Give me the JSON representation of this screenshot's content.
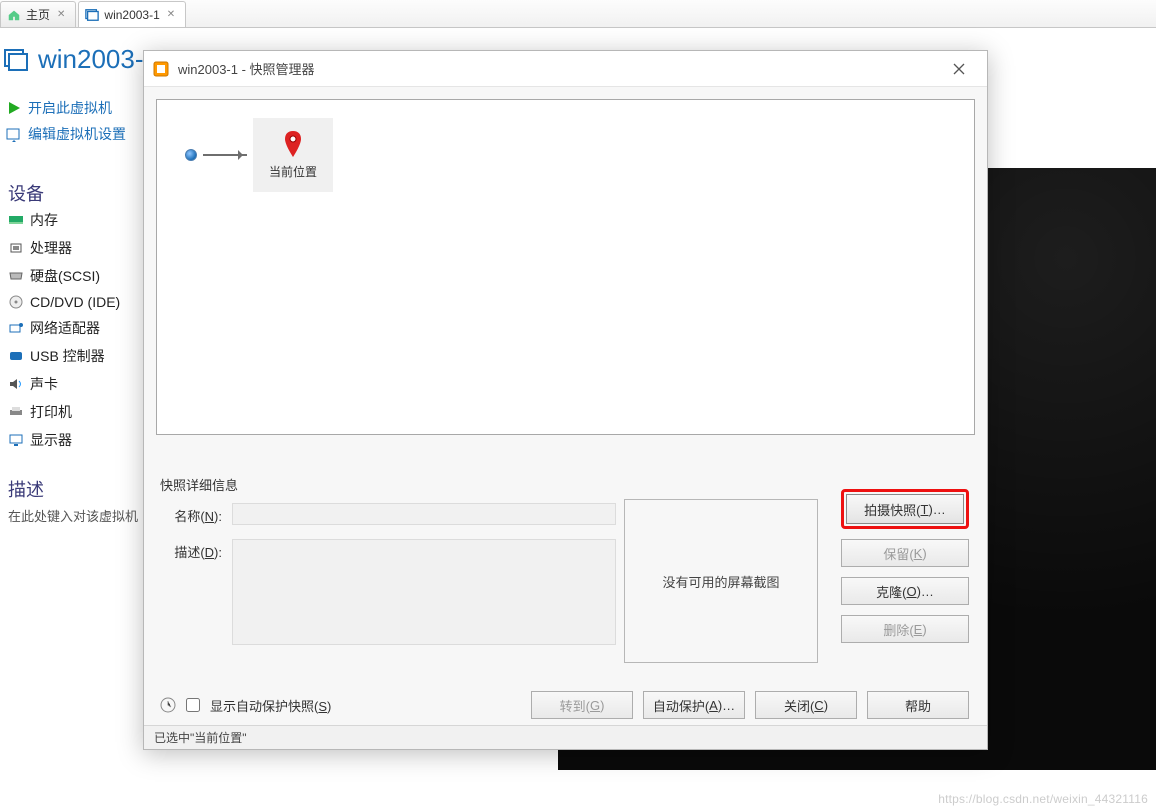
{
  "tabs": {
    "home": "主页",
    "vm": "win2003-1"
  },
  "vm": {
    "title": "win2003-",
    "power_on": "开启此虚拟机",
    "edit_settings": "编辑虚拟机设置"
  },
  "devices_header": "设备",
  "devices": {
    "memory": "内存",
    "cpu": "处理器",
    "disk": "硬盘(SCSI)",
    "cd": "CD/DVD (IDE)",
    "net": "网络适配器",
    "usb": "USB 控制器",
    "sound": "声卡",
    "printer": "打印机",
    "display": "显示器"
  },
  "desc_header": "描述",
  "desc_body": "在此处键入对该虚拟机",
  "modal": {
    "title": "win2003-1 - 快照管理器",
    "current_location": "当前位置",
    "details_label": "快照详细信息",
    "name_label_pre": "名称(",
    "name_label_u": "N",
    "name_label_post": "):",
    "desc_label_pre": "描述(",
    "desc_label_u": "D",
    "desc_label_post": "):",
    "no_screenshot": "没有可用的屏幕截图",
    "take_snapshot_pre": "拍摄快照(",
    "take_snapshot_u": "T",
    "take_snapshot_post": ")…",
    "keep_pre": "保留(",
    "keep_u": "K",
    "keep_post": ")",
    "clone_pre": "克隆(",
    "clone_u": "O",
    "clone_post": ")…",
    "delete_pre": "删除(",
    "delete_u": "E",
    "delete_post": ")",
    "show_autoprotect_pre": "显示自动保护快照(",
    "show_autoprotect_u": "S",
    "show_autoprotect_post": ")",
    "goto_pre": "转到(",
    "goto_u": "G",
    "goto_post": ")",
    "autoprotect_pre": "自动保护(",
    "autoprotect_u": "A",
    "autoprotect_post": ")…",
    "close_pre": "关闭(",
    "close_u": "C",
    "close_post": ")",
    "help": "帮助",
    "statusbar": "已选中\"当前位置\""
  },
  "watermark": "https://blog.csdn.net/weixin_44321116"
}
